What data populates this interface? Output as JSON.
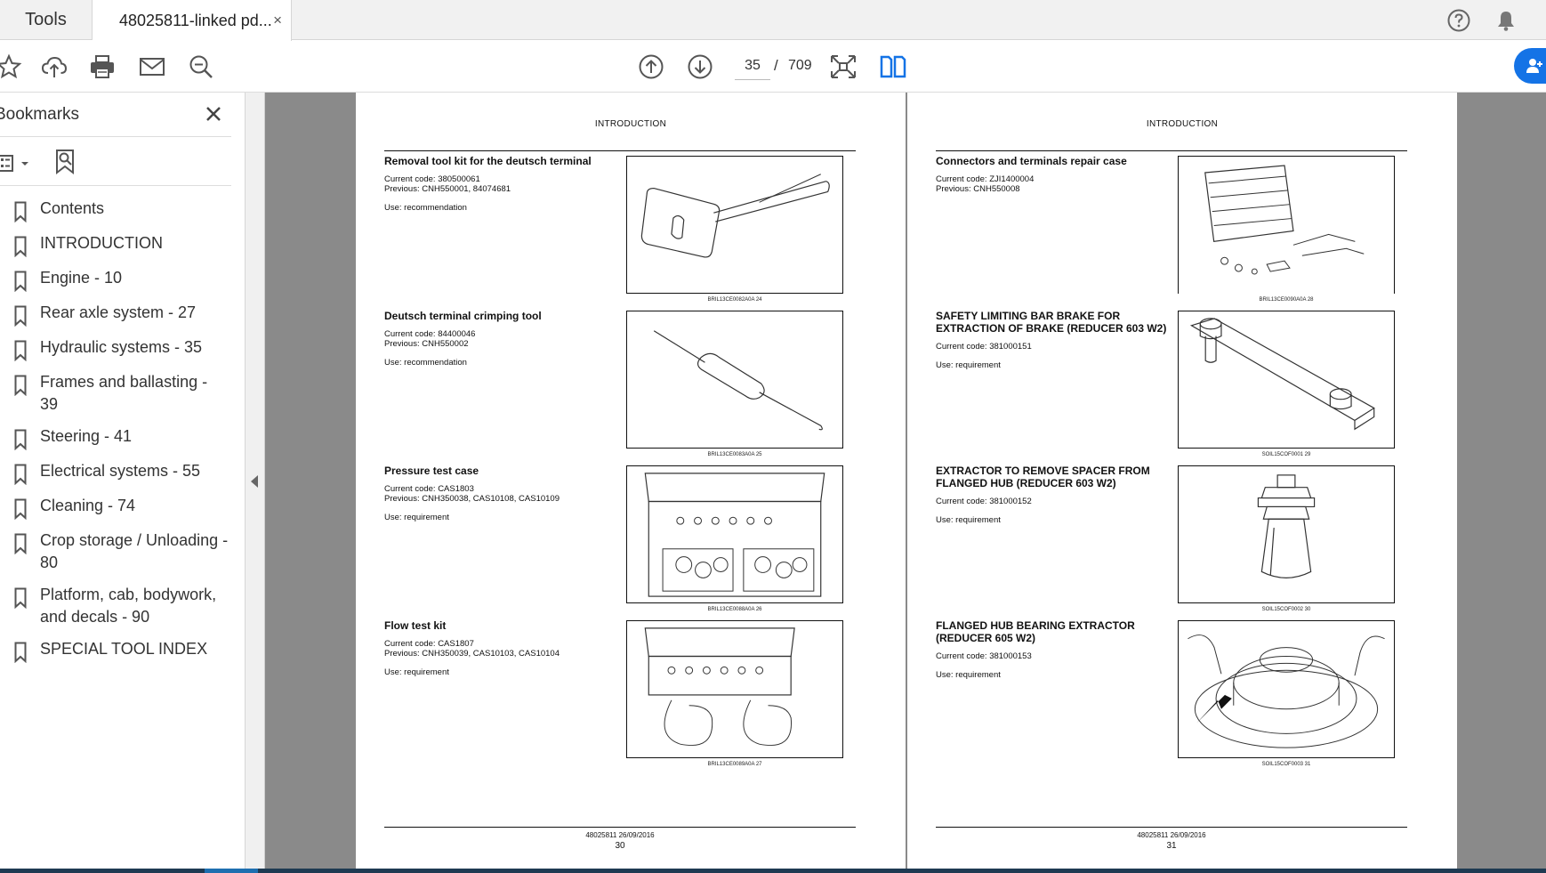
{
  "tabs": {
    "tools": "Tools",
    "document": "48025811-linked pd...",
    "close_symbol": "×"
  },
  "header_icons": [
    "help-icon",
    "notifications-bell-icon"
  ],
  "toolbar": {
    "icons": [
      "bookmark-star-icon",
      "upload-cloud-icon",
      "print-icon",
      "email-icon",
      "zoom-search-icon"
    ],
    "nav_icons": [
      "previous-page-icon",
      "next-page-icon",
      "fit-page-icon",
      "two-page-view-icon"
    ],
    "current_page": "35",
    "page_separator": "/",
    "total_pages": "709",
    "accent_color": "#1473e6"
  },
  "sidebar": {
    "title": "Bookmarks",
    "items": [
      {
        "label": "Contents"
      },
      {
        "label": "INTRODUCTION"
      },
      {
        "label": "Engine - 10"
      },
      {
        "label": "Rear axle system - 27"
      },
      {
        "label": "Hydraulic systems - 35"
      },
      {
        "label": "Frames and ballasting - 39"
      },
      {
        "label": "Steering - 41"
      },
      {
        "label": "Electrical systems - 55"
      },
      {
        "label": "Cleaning - 74"
      },
      {
        "label": "Crop storage / Unloading - 80"
      },
      {
        "label": "Platform, cab, bodywork, and decals - 90"
      },
      {
        "label": "SPECIAL TOOL INDEX"
      }
    ]
  },
  "pages": {
    "left": {
      "header": "INTRODUCTION",
      "footer_code": "48025811 26/09/2016",
      "page_number": "30",
      "entries": [
        {
          "title": "Removal tool kit for the deutsch terminal",
          "current_code": "Current code: 380500061",
          "previous": "Previous: CNH550001, 84074681",
          "use": "Use: recommendation",
          "figure_caption": "BRIL13CE0082A0A    24"
        },
        {
          "title": "Deutsch terminal crimping tool",
          "current_code": "Current code: 84400046",
          "previous": "Previous: CNH550002",
          "use": "Use: recommendation",
          "figure_caption": "BRIL13CE0083A0A    25"
        },
        {
          "title": "Pressure test case",
          "current_code": "Current code: CAS1803",
          "previous": "Previous: CNH350038, CAS10108, CAS10109",
          "use": "Use: requirement",
          "figure_caption": "BRIL13CE0088A0A    26"
        },
        {
          "title": "Flow test kit",
          "current_code": "Current code: CAS1807",
          "previous": "Previous: CNH350039, CAS10103, CAS10104",
          "use": "Use: requirement",
          "figure_caption": "BRIL13CE0089A0A    27"
        }
      ]
    },
    "right": {
      "header": "INTRODUCTION",
      "footer_code": "48025811 26/09/2016",
      "page_number": "31",
      "entries": [
        {
          "title": "Connectors and terminals repair case",
          "current_code": "Current code: ZJI1400004",
          "previous": "Previous: CNH550008",
          "use": "",
          "figure_caption": "BRIL13CE0090A0A    28"
        },
        {
          "title": "SAFETY LIMITING BAR BRAKE FOR EXTRACTION OF BRAKE (REDUCER 603 W2)",
          "current_code": "Current code: 381000151",
          "previous": "",
          "use": "Use: requirement",
          "figure_caption": "SOIL15COF0001    29"
        },
        {
          "title": "EXTRACTOR TO REMOVE SPACER FROM FLANGED HUB (REDUCER 603 W2)",
          "current_code": "Current code: 381000152",
          "previous": "",
          "use": "Use: requirement",
          "figure_caption": "SOIL15COF0002    30"
        },
        {
          "title": "FLANGED HUB BEARING EXTRACTOR (REDUCER 605 W2)",
          "current_code": "Current code: 381000153",
          "previous": "",
          "use": "Use: requirement",
          "figure_caption": "SOIL15COF0003    31"
        }
      ]
    }
  }
}
